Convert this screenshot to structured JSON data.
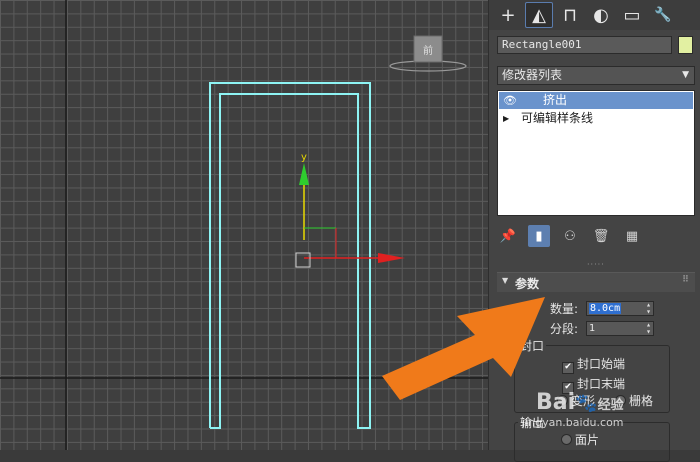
{
  "command_panel": {
    "tabs": [
      {
        "icon": "plus-icon",
        "glyph": "+"
      },
      {
        "icon": "modify-icon",
        "glyph": "◭"
      },
      {
        "icon": "hierarchy-icon",
        "glyph": "⊓"
      },
      {
        "icon": "motion-icon",
        "glyph": "◐"
      },
      {
        "icon": "display-icon",
        "glyph": "▭"
      },
      {
        "icon": "utilities-icon",
        "glyph": "🔧"
      }
    ],
    "object_name": "Rectangle001",
    "object_color": "#e2f0a2",
    "modifier_list_label": "修改器列表",
    "stack": [
      {
        "label": "挤出",
        "selected": true,
        "icon": "eye-icon"
      },
      {
        "label": "可编辑样条线",
        "selected": false,
        "icon": "expand-arrow-icon"
      }
    ],
    "stack_tools": [
      "pin-stack-icon",
      "show-end-result-icon",
      "make-unique-icon",
      "remove-modifier-icon",
      "configure-sets-icon"
    ]
  },
  "parameters": {
    "title": "参数",
    "amount_label": "数量:",
    "amount_value": "8.0cm",
    "segments_label": "分段:",
    "segments_value": "1",
    "capping_label": "封口",
    "cap_start_label": "封口始端",
    "cap_end_label": "封口末端",
    "morph_label": "变形",
    "grid_label": "栅格",
    "output_label": "输出",
    "patch_label": "面片"
  },
  "watermark": {
    "brand": "Bai",
    "suffix": "经验",
    "url": "jingyan.baidu.com"
  },
  "colors": {
    "shape_selected": "#8ef4f4",
    "axis_y": "#2ecc2e",
    "axis_x": "#e02020",
    "highlight_blue": "#6a93cc",
    "arrow_orange": "#f07a1a"
  }
}
